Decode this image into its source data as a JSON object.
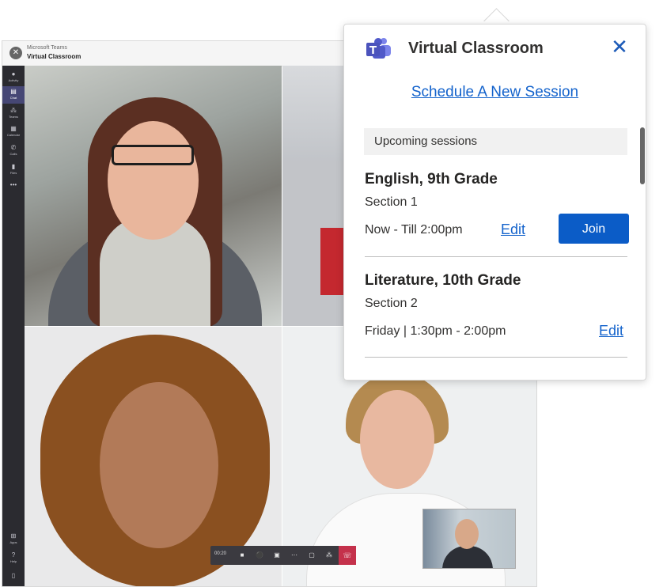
{
  "teams_window": {
    "app_name": "Microsoft Teams",
    "title": "Virtual Classroom",
    "rail": [
      {
        "label": "Activity",
        "icon": "bell-icon",
        "glyph": "🔔"
      },
      {
        "label": "Chat",
        "icon": "chat-icon",
        "glyph": "▤",
        "active": true
      },
      {
        "label": "Teams",
        "icon": "teams-icon",
        "glyph": "⁂"
      },
      {
        "label": "Calendar",
        "icon": "calendar-icon",
        "glyph": "▦"
      },
      {
        "label": "Calls",
        "icon": "phone-icon",
        "glyph": "✆"
      },
      {
        "label": "Files",
        "icon": "file-icon",
        "glyph": "▮"
      },
      {
        "label": "",
        "icon": "more-icon",
        "glyph": "•••"
      }
    ],
    "rail_bottom": [
      {
        "label": "Apps",
        "icon": "apps-icon",
        "glyph": "⊞"
      },
      {
        "label": "Help",
        "icon": "help-icon",
        "glyph": "?"
      }
    ],
    "call_bar": {
      "timer": "00:20"
    }
  },
  "popup": {
    "title": "Virtual Classroom",
    "schedule_link": "Schedule A New Session",
    "upcoming_header": "Upcoming sessions",
    "sessions": [
      {
        "title": "English, 9th Grade",
        "section": "Section 1",
        "time": "Now - Till 2:00pm",
        "edit_label": "Edit",
        "join_label": "Join"
      },
      {
        "title": "Literature, 10th Grade",
        "section": "Section 2",
        "time": "Friday | 1:30pm - 2:00pm",
        "edit_label": "Edit"
      }
    ]
  },
  "colors": {
    "accent": "#1463cc",
    "join_button": "#0b5cc7",
    "teams_purple": "#464775",
    "hangup": "#c4314b"
  }
}
